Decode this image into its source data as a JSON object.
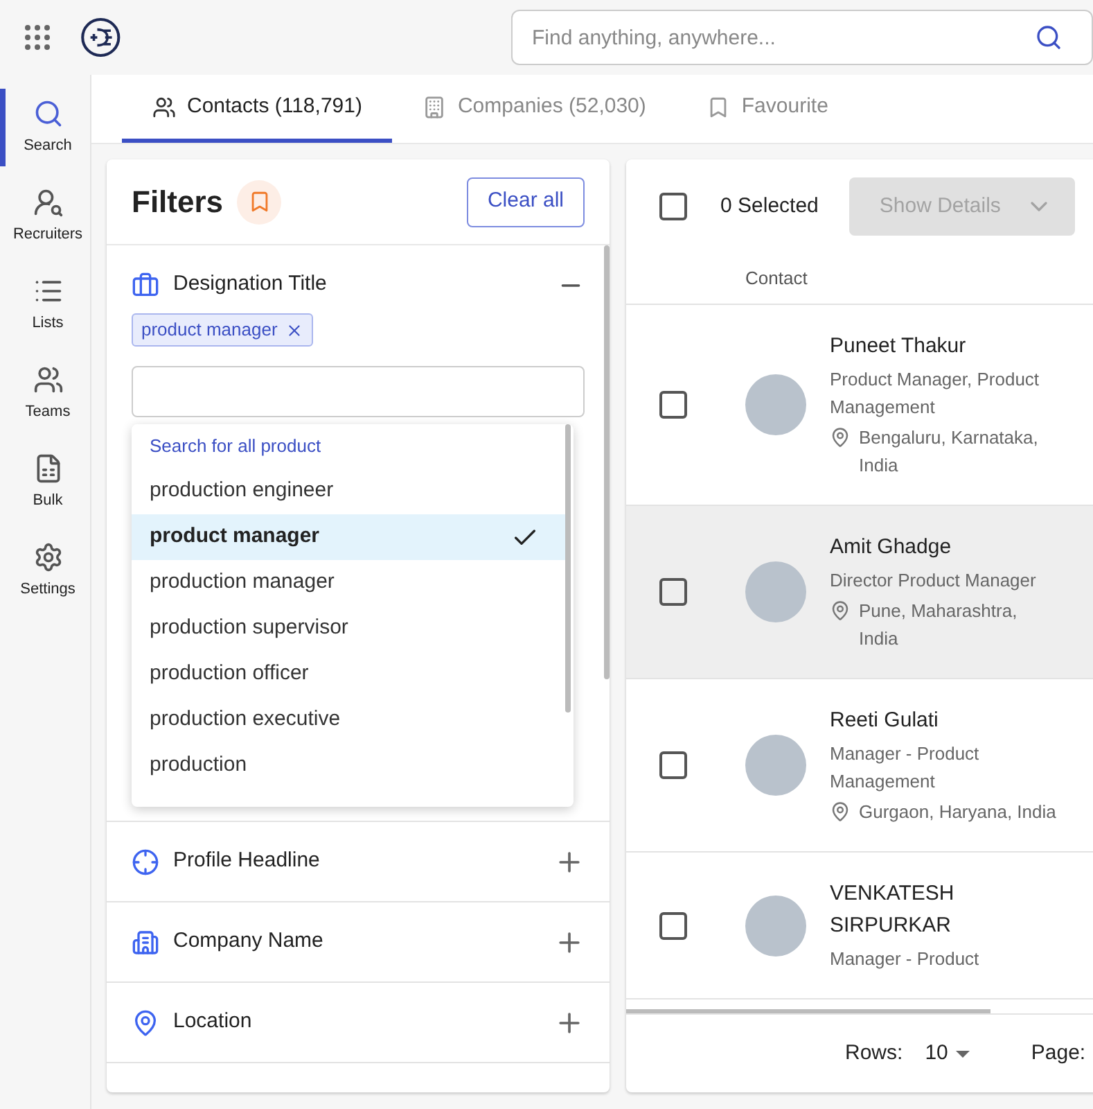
{
  "search": {
    "placeholder": "Find anything, anywhere..."
  },
  "sidebar": {
    "items": [
      {
        "kind": "search",
        "label": "Search",
        "selected": true
      },
      {
        "kind": "recruiters",
        "label": "Recruiters",
        "selected": false
      },
      {
        "kind": "lists",
        "label": "Lists",
        "selected": false
      },
      {
        "kind": "teams",
        "label": "Teams",
        "selected": false
      },
      {
        "kind": "bulk",
        "label": "Bulk",
        "selected": false
      },
      {
        "kind": "settings",
        "label": "Settings",
        "selected": false
      }
    ]
  },
  "tabs": [
    {
      "kind": "contacts",
      "label": "Contacts (118,791)",
      "selected": true
    },
    {
      "kind": "companies",
      "label": "Companies (52,030)",
      "selected": false
    },
    {
      "kind": "favourite",
      "label": "Favourite",
      "selected": false
    }
  ],
  "filters": {
    "title": "Filters",
    "clear_button": "Clear all",
    "sections": [
      {
        "kind": "designation",
        "title": "Designation Title",
        "expanded": true,
        "tags": [
          "product manager"
        ],
        "suggestions": {
          "search_all": "Search for all product",
          "options": [
            {
              "label": "production engineer",
              "selected": false
            },
            {
              "label": "product manager",
              "selected": true
            },
            {
              "label": "production manager",
              "selected": false
            },
            {
              "label": "production supervisor",
              "selected": false
            },
            {
              "label": "production officer",
              "selected": false
            },
            {
              "label": "production executive",
              "selected": false
            },
            {
              "label": "production",
              "selected": false
            }
          ]
        }
      },
      {
        "kind": "headline",
        "title": "Profile Headline",
        "expanded": false
      },
      {
        "kind": "company",
        "title": "Company Name",
        "expanded": false
      },
      {
        "kind": "location",
        "title": "Location",
        "expanded": false
      }
    ]
  },
  "results": {
    "select_all_checked": false,
    "selected_count": "0 Selected",
    "show_details_button": "Show Details",
    "columns": [
      "Contact"
    ],
    "rows": [
      {
        "name": "Puneet Thakur",
        "title": "Product Manager, Product Management",
        "location": "Bengaluru, Karnataka, India",
        "checked": false,
        "highlighted": false
      },
      {
        "name": "Amit Ghadge",
        "title": "Director Product Manager",
        "location": "Pune, Maharashtra, India",
        "checked": false,
        "highlighted": true
      },
      {
        "name": "Reeti Gulati",
        "title": "Manager - Product Management",
        "location": "Gurgaon, Haryana, India",
        "checked": false,
        "highlighted": false
      },
      {
        "name": "VENKATESH SIRPURKAR",
        "title": "Manager - Product",
        "checked": false,
        "highlighted": false
      }
    ],
    "footer": {
      "rows_label": "Rows:",
      "rows_value": "10",
      "page_label": "Page:"
    }
  }
}
